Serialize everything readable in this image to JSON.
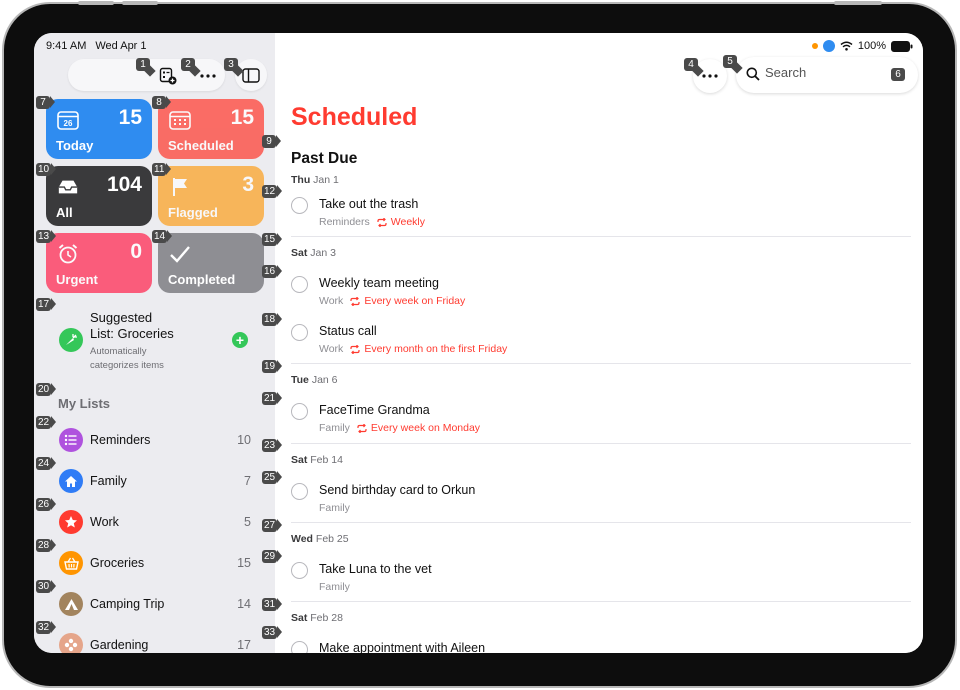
{
  "status_bar": {
    "time": "9:41 AM",
    "date": "Wed Apr 1",
    "battery": "100%"
  },
  "colors": {
    "today": "#2f8cf0",
    "scheduled": "#ff3b30",
    "all": "#3a3a3c",
    "flagged": "#ff9500",
    "urgent": "#ff2d55",
    "completed": "#8e8e93",
    "accent_red": "#ff3b30"
  },
  "tiles": {
    "today": {
      "label": "Today",
      "count": "15",
      "icon": "calendar-day-icon",
      "day": "26"
    },
    "scheduled": {
      "label": "Scheduled",
      "count": "15",
      "icon": "calendar-grid-icon"
    },
    "all": {
      "label": "All",
      "count": "104",
      "icon": "tray-icon"
    },
    "flagged": {
      "label": "Flagged",
      "count": "3",
      "icon": "flag-icon"
    },
    "urgent": {
      "label": "Urgent",
      "count": "0",
      "icon": "alarm-clock-icon"
    },
    "completed": {
      "label": "Completed",
      "icon": "checkmark-icon"
    }
  },
  "suggested": {
    "title_line1": "Suggested",
    "title_line2": "List: Groceries",
    "subtitle_line1": "Automatically",
    "subtitle_line2": "categorizes items",
    "icon": "carrot-icon"
  },
  "my_lists": {
    "heading": "My Lists",
    "items": [
      {
        "name": "Reminders",
        "count": "10",
        "icon": "list-icon",
        "color": "#af52de"
      },
      {
        "name": "Family",
        "count": "7",
        "icon": "house-icon",
        "color": "#2f7cf6"
      },
      {
        "name": "Work",
        "count": "5",
        "icon": "star-icon",
        "color": "#ff3b30"
      },
      {
        "name": "Groceries",
        "count": "15",
        "icon": "basket-icon",
        "color": "#ff9500"
      },
      {
        "name": "Camping Trip",
        "count": "14",
        "icon": "tent-icon",
        "color": "#a2845e"
      },
      {
        "name": "Gardening",
        "count": "17",
        "icon": "flower-icon",
        "color": "#e5a58a"
      }
    ]
  },
  "search": {
    "placeholder": "Search"
  },
  "main": {
    "title": "Scheduled",
    "section": "Past Due",
    "groups": [
      {
        "day": "Thu",
        "date": "Jan 1",
        "tasks": [
          {
            "title": "Take out the trash",
            "list": "Reminders",
            "repeat": "Weekly"
          }
        ]
      },
      {
        "day": "Sat",
        "date": "Jan 3",
        "tasks": [
          {
            "title": "Weekly team meeting",
            "list": "Work",
            "repeat": "Every week on Friday"
          },
          {
            "title": "Status call",
            "list": "Work",
            "repeat": "Every month on the first Friday"
          }
        ]
      },
      {
        "day": "Tue",
        "date": "Jan 6",
        "tasks": [
          {
            "title": "FaceTime Grandma",
            "list": "Family",
            "repeat": "Every week on Monday"
          }
        ]
      },
      {
        "day": "Sat",
        "date": "Feb 14",
        "tasks": [
          {
            "title": "Send birthday card to Orkun",
            "list": "Family",
            "repeat": ""
          }
        ]
      },
      {
        "day": "Wed",
        "date": "Feb 25",
        "tasks": [
          {
            "title": "Take Luna to the vet",
            "list": "Family",
            "repeat": ""
          }
        ]
      },
      {
        "day": "Sat",
        "date": "Feb 28",
        "tasks": [
          {
            "title": "Make appointment with Aileen",
            "list": "",
            "repeat": ""
          }
        ]
      }
    ]
  },
  "badges": [
    "1",
    "2",
    "3",
    "4",
    "5",
    "6",
    "7",
    "8",
    "9",
    "10",
    "11",
    "12",
    "13",
    "14",
    "15",
    "16",
    "17",
    "18",
    "19",
    "20",
    "21",
    "22",
    "23",
    "24",
    "25",
    "26",
    "27",
    "28",
    "29",
    "30",
    "31",
    "32",
    "33"
  ]
}
